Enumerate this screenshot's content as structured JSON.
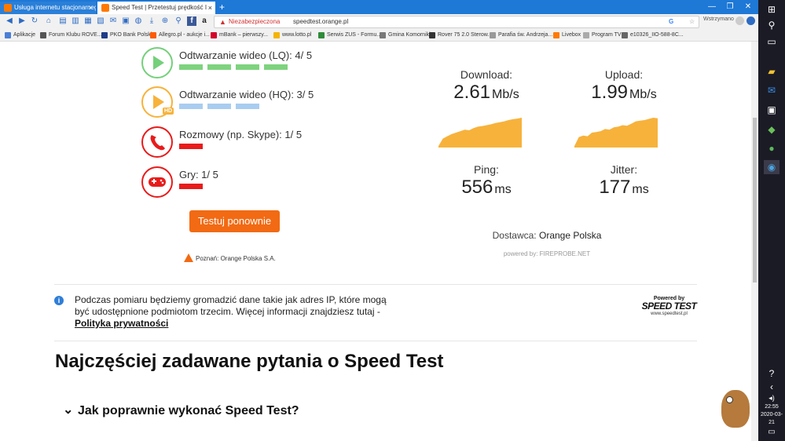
{
  "browser": {
    "tabs": [
      {
        "title": "Usługa internetu stacjonarnego N",
        "close": "×"
      },
      {
        "title": "Speed Test | Przetestuj prędkość I",
        "close": "×"
      }
    ],
    "new_tab": "+",
    "window_controls": {
      "minimize": "—",
      "maximize": "❐",
      "close": "✕"
    },
    "security_label": "Niezabezpieczona",
    "url": "speedtest.orange.pl",
    "search_engine": "G",
    "profile": "Wstrzymano",
    "bookmarks": [
      {
        "label": "Aplikacje",
        "color": "#4a7fd6"
      },
      {
        "label": "Forum Klubu ROVE...",
        "color": "#555555"
      },
      {
        "label": "PKO Bank Polski",
        "color": "#1d3c87"
      },
      {
        "label": "Allegro.pl - aukcje i...",
        "color": "#ff5a00"
      },
      {
        "label": "mBank – pierwszy...",
        "color": "#d4002a"
      },
      {
        "label": "www.lotto.pl",
        "color": "#f5b400"
      },
      {
        "label": "Serwis ZUS - Formu...",
        "color": "#2e8b3a"
      },
      {
        "label": "Gmina Komorniki",
        "color": "#777777"
      },
      {
        "label": "Rover 75 2.0 Sterow...",
        "color": "#333333"
      },
      {
        "label": "Parafia św. Andrzeja...",
        "color": "#999999"
      },
      {
        "label": "Livebox",
        "color": "#ff7900"
      },
      {
        "label": "Program TV",
        "color": "#aaaaaa"
      },
      {
        "label": "e10326_IIO-588-8C...",
        "color": "#666666"
      }
    ]
  },
  "results": {
    "rows": [
      {
        "label": "Odtwarzanie wideo (LQ): 4/ 5",
        "score": 4,
        "max": 5,
        "color": "#7ed37e",
        "icon": "play-icon"
      },
      {
        "label": "Odtwarzanie wideo (HQ): 3/ 5",
        "score": 3,
        "max": 5,
        "color": "#a9cdf0",
        "icon": "play-hd-icon",
        "badge": "HD"
      },
      {
        "label": "Rozmowy (np. Skype): 1/ 5",
        "score": 1,
        "max": 5,
        "color": "#e81b1b",
        "icon": "phone-icon"
      },
      {
        "label": "Gry: 1/ 5",
        "score": 1,
        "max": 5,
        "color": "#e81b1b",
        "icon": "gamepad-icon"
      }
    ],
    "retest_button": "Testuj ponownie",
    "location": "Poznań: Orange Polska S.A."
  },
  "metrics": {
    "download": {
      "label": "Download:",
      "value": "2.61",
      "unit": "Mb/s"
    },
    "upload": {
      "label": "Upload:",
      "value": "1.99",
      "unit": "Mb/s"
    },
    "ping": {
      "label": "Ping:",
      "value": "556",
      "unit": "ms"
    },
    "jitter": {
      "label": "Jitter:",
      "value": "177",
      "unit": "ms"
    },
    "provider_label": "Dostawca:",
    "provider_name": "Orange Polska",
    "powered": "powered by: FIREPROBE.NET",
    "chart_color": "#f7b23b"
  },
  "privacy": {
    "text": "Podczas pomiaru będziemy gromadzić dane takie jak adres IP, które mogą być udostępnione podmiotom trzecim. Więcej informacji znajdziesz tutaj -",
    "link": "Polityka prywatności",
    "logo_top": "Powered by",
    "logo_main": "SPEED TEST",
    "logo_url": "www.speedtest.pl"
  },
  "faq": {
    "title": "Najczęściej zadawane pytania o Speed Test",
    "q1": "Jak poprawnie wykonać Speed Test?"
  },
  "taskbar": {
    "time": "22:55",
    "date": "2020-03-21"
  }
}
